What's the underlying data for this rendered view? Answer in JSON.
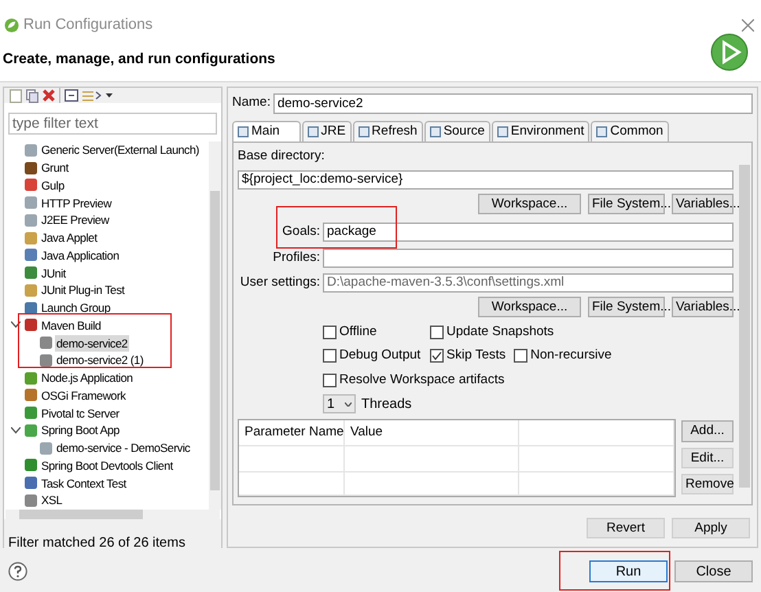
{
  "window": {
    "title": "Run Configurations"
  },
  "header": {
    "title": "Create, manage, and run configurations"
  },
  "sidebar": {
    "filter_placeholder": "type filter text",
    "items": [
      {
        "label": "Generic Server(External Launch)",
        "selected": false
      },
      {
        "label": "Grunt",
        "selected": false
      },
      {
        "label": "Gulp",
        "selected": false
      },
      {
        "label": "HTTP Preview",
        "selected": false
      },
      {
        "label": "J2EE Preview",
        "selected": false
      },
      {
        "label": "Java Applet",
        "selected": false
      },
      {
        "label": "Java Application",
        "selected": false
      },
      {
        "label": "JUnit",
        "selected": false
      },
      {
        "label": "JUnit Plug-in Test",
        "selected": false
      },
      {
        "label": "Launch Group",
        "selected": false
      },
      {
        "label": "Maven Build",
        "selected": false,
        "expanded": true,
        "children": [
          {
            "label": "demo-service2",
            "selected": true
          },
          {
            "label": "demo-service2 (1)",
            "selected": false
          }
        ]
      },
      {
        "label": "Node.js Application",
        "selected": false
      },
      {
        "label": "OSGi Framework",
        "selected": false
      },
      {
        "label": "Pivotal tc Server",
        "selected": false
      },
      {
        "label": "Spring Boot App",
        "selected": false,
        "expanded": true,
        "children": [
          {
            "label": "demo-service - DemoServic",
            "selected": false
          }
        ]
      },
      {
        "label": "Spring Boot Devtools Client",
        "selected": false
      },
      {
        "label": "Task Context Test",
        "selected": false
      },
      {
        "label": "XSL",
        "selected": false
      }
    ],
    "status": "Filter matched 26 of 26 items"
  },
  "name": {
    "label": "Name:",
    "value": "demo-service2"
  },
  "tabs": [
    {
      "label": "Main",
      "selected": true
    },
    {
      "label": "JRE",
      "selected": false
    },
    {
      "label": "Refresh",
      "selected": false
    },
    {
      "label": "Source",
      "selected": false
    },
    {
      "label": "Environment",
      "selected": false
    },
    {
      "label": "Common",
      "selected": false
    }
  ],
  "main": {
    "base_directory_label": "Base directory:",
    "base_directory": "${project_loc:demo-service}",
    "buttons_1": [
      {
        "label": "Workspace...",
        "disabled": false
      },
      {
        "label": "File System...",
        "disabled": false
      },
      {
        "label": "Variables...",
        "disabled": false
      }
    ],
    "fields": [
      {
        "label": "Goals:",
        "value": "package"
      },
      {
        "label": "Profiles:"
      },
      {
        "label": "User settings:",
        "value": "D:\\apache-maven-3.5.3\\conf\\settings.xml"
      }
    ],
    "buttons_2": [
      {
        "label": "Workspace...",
        "disabled": false
      },
      {
        "label": "File System...",
        "disabled": false
      },
      {
        "label": "Variables...",
        "disabled": false
      }
    ],
    "options": [
      [
        {
          "label": "Offline",
          "checked": false
        },
        {
          "label": "Update Snapshots",
          "checked": false
        }
      ],
      [
        {
          "label": "Debug Output",
          "checked": false
        },
        {
          "label": "Skip Tests",
          "checked": true
        },
        {
          "label": "Non-recursive",
          "checked": false
        }
      ],
      [
        {
          "label": "Resolve Workspace artifacts",
          "checked": false
        }
      ]
    ],
    "threads": {
      "value": "1",
      "label": "Threads"
    },
    "table": {
      "columns": [
        "Parameter Name",
        "Value"
      ]
    },
    "table_buttons": [
      {
        "label": "Add...",
        "disabled": false
      },
      {
        "label": "Edit...",
        "disabled": true
      },
      {
        "label": "Remove",
        "disabled": true
      }
    ]
  },
  "actions": [
    {
      "label": "Revert",
      "disabled": true
    },
    {
      "label": "Apply",
      "disabled": true
    }
  ],
  "footer": [
    {
      "label": "Run",
      "default": true
    },
    {
      "label": "Close",
      "default": false
    }
  ]
}
